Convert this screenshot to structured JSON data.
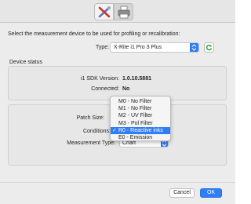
{
  "toolbar": {
    "tabs": [
      {
        "name": "tools",
        "icon": "tools-icon",
        "selected": false
      },
      {
        "name": "printer",
        "icon": "printer-icon",
        "selected": true
      }
    ]
  },
  "header": {
    "intro_text": "Select the measurement device to be used for profiling or recalibration:"
  },
  "device": {
    "type_label": "Type:",
    "selected": "X-Rite i1 Pro 3 Plus"
  },
  "status": {
    "title": "Device status",
    "sdk_label": "i1 SDK Version:",
    "sdk_value": "1.0.10.5881",
    "connected_label": "Connected:",
    "connected_value": "No"
  },
  "measurement": {
    "patch_size_label": "Patch Size:",
    "conditions_label": "Conditions:",
    "measurement_type_label": "Measurement Type:",
    "measurement_type_value": "Chart"
  },
  "conditions_menu": {
    "items": [
      {
        "label": "M0 - No Filter",
        "checked": false
      },
      {
        "label": "M1 - No Filter",
        "checked": false
      },
      {
        "label": "M2 - UV Filter",
        "checked": false
      },
      {
        "label": "M3 - Pol Filter",
        "checked": false
      },
      {
        "label": "R0 - Reactive inks",
        "checked": true
      },
      {
        "label": "E0 - Emission",
        "checked": false
      }
    ],
    "check_mark": "✓"
  },
  "buttons": {
    "cancel": "Cancel",
    "ok": "OK"
  },
  "colors": {
    "accent": "#2f7ef5",
    "window_bg": "#ececec",
    "refresh_green": "#2eaa3a"
  }
}
